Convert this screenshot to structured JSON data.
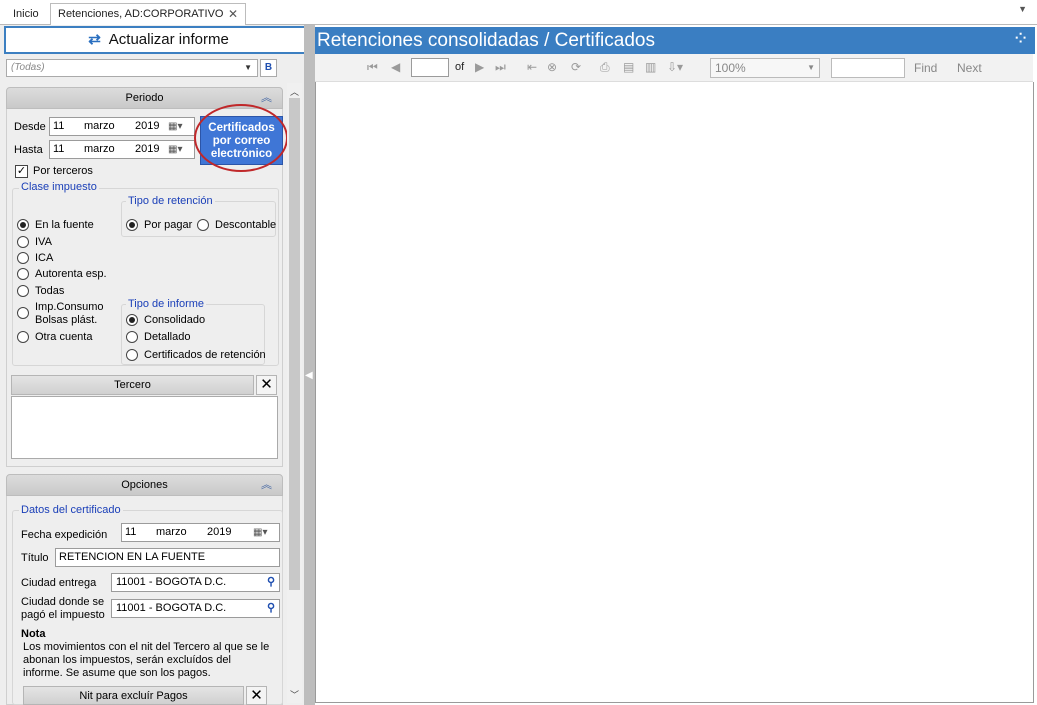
{
  "tabs": [
    {
      "label": "Inicio"
    },
    {
      "label": "Retenciones, AD:CORPORATIVO"
    }
  ],
  "update_button": "Actualizar informe",
  "filter_combo": {
    "value": "(Todas)",
    "b_label": "B"
  },
  "period": {
    "header": "Periodo",
    "desde_label": "Desde",
    "hasta_label": "Hasta",
    "desde": {
      "day": "11",
      "month": "marzo",
      "year": "2019"
    },
    "hasta": {
      "day": "11",
      "month": "marzo",
      "year": "2019"
    },
    "certificados_button": [
      "Certificados",
      "por correo",
      "electrónico"
    ],
    "por_terceros": "Por terceros",
    "clase_impuesto_title": "Clase impuesto",
    "clase_impuesto": [
      "En la fuente",
      "IVA",
      "ICA",
      "Autorenta esp.",
      "Todas",
      "Imp.Consumo",
      "Bolsas plást.",
      "Otra cuenta"
    ],
    "tipo_retencion_title": "Tipo de retención",
    "tipo_retencion": [
      "Por pagar",
      "Descontable"
    ],
    "tipo_informe_title": "Tipo de informe",
    "tipo_informe": [
      "Consolidado",
      "Detallado",
      "Certificados de retención"
    ],
    "tercero_header": "Tercero"
  },
  "options": {
    "header": "Opciones",
    "datos_title": "Datos del certificado",
    "fecha_label": "Fecha expedición",
    "fecha": {
      "day": "11",
      "month": "marzo",
      "year": "2019"
    },
    "titulo_label": "Título",
    "titulo_value": "RETENCION EN LA FUENTE",
    "ciudad_entrega_label": "Ciudad entrega",
    "ciudad_entrega_value": "11001 - BOGOTA D.C.",
    "ciudad_pago_label_1": "Ciudad donde se",
    "ciudad_pago_label_2": "pagó el impuesto",
    "ciudad_pago_value": "11001 - BOGOTA D.C.",
    "nota_title": "Nota",
    "nota_lines": [
      "Los movimientos con el nit del Tercero al que se le",
      "abonan los impuestos, serán excluídos del",
      "informe. Se asume que son los pagos."
    ],
    "nit_header": "Nit para excluír Pagos"
  },
  "report": {
    "title": "Retenciones consolidadas / Certificados",
    "of_label": "of",
    "zoom": "100%",
    "find_label": "Find",
    "next_label": "Next"
  }
}
